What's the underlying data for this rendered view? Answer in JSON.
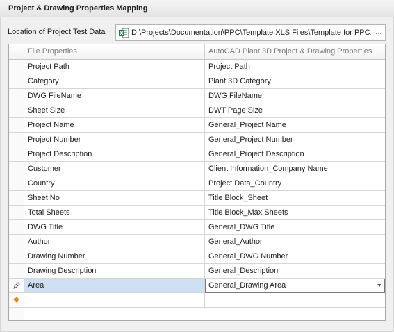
{
  "header": {
    "title": "Project & Drawing Properties Mapping"
  },
  "location": {
    "label": "Location of Project Test Data",
    "value": "D:\\Projects\\Documentation\\PPC\\Template XLS Files\\Template for PPC.xls",
    "browse_label": "...",
    "file_icon": "excel-icon"
  },
  "grid": {
    "columns": [
      "File Properties",
      "AutoCAD Plant 3D Project & Drawing Properties"
    ],
    "rows": [
      {
        "file": "Project Path",
        "acad": "Project Path"
      },
      {
        "file": "Category",
        "acad": "Plant 3D Category"
      },
      {
        "file": "DWG FileName",
        "acad": "DWG FileName"
      },
      {
        "file": "Sheet Size",
        "acad": "DWT Page Size"
      },
      {
        "file": "Project Name",
        "acad": "General_Project Name"
      },
      {
        "file": "Project Number",
        "acad": "General_Project Number"
      },
      {
        "file": "Project Description",
        "acad": "General_Project Description"
      },
      {
        "file": "Customer",
        "acad": "Client Information_Company Name"
      },
      {
        "file": "Country",
        "acad": "Project Data_Country"
      },
      {
        "file": "Sheet No",
        "acad": "Title Block_Sheet"
      },
      {
        "file": "Total Sheets",
        "acad": "Title Block_Max Sheets"
      },
      {
        "file": "DWG Title",
        "acad": "General_DWG Title"
      },
      {
        "file": "Author",
        "acad": "General_Author"
      },
      {
        "file": "Drawing Number",
        "acad": "General_DWG Number"
      },
      {
        "file": "Drawing Description",
        "acad": "General_Description"
      },
      {
        "file": "Area",
        "acad": "General_Drawing Area",
        "editing": true
      }
    ],
    "editing_indicator_icon": "pencil-icon",
    "new_row_indicator_icon": "new-row-star-icon"
  }
}
